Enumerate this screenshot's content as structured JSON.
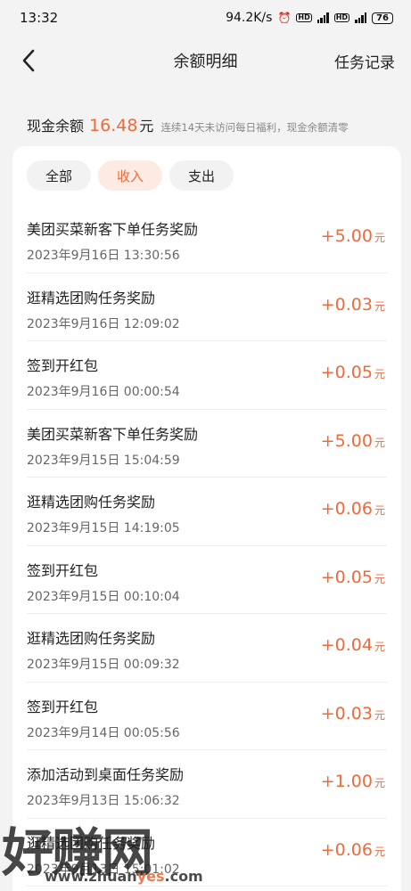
{
  "status_bar": {
    "time": "13:32",
    "network_speed": "94.2K/s",
    "battery": "76"
  },
  "nav": {
    "title": "余额明细",
    "right_link": "任务记录"
  },
  "balance": {
    "label": "现金余额",
    "amount": "16.48",
    "unit": "元",
    "note": "连续14天未访问每日福利，现金余额清零"
  },
  "tabs": [
    {
      "label": "全部",
      "active": false
    },
    {
      "label": "收入",
      "active": true
    },
    {
      "label": "支出",
      "active": false
    }
  ],
  "records": [
    {
      "title": "美团买菜新客下单任务奖励",
      "time": "2023年9月16日 13:30:56",
      "amount": "+5.00",
      "unit": "元"
    },
    {
      "title": "逛精选团购任务奖励",
      "time": "2023年9月16日 12:09:02",
      "amount": "+0.03",
      "unit": "元"
    },
    {
      "title": "签到开红包",
      "time": "2023年9月16日 00:00:54",
      "amount": "+0.05",
      "unit": "元"
    },
    {
      "title": "美团买菜新客下单任务奖励",
      "time": "2023年9月15日 15:04:59",
      "amount": "+5.00",
      "unit": "元"
    },
    {
      "title": "逛精选团购任务奖励",
      "time": "2023年9月15日 14:19:05",
      "amount": "+0.06",
      "unit": "元"
    },
    {
      "title": "签到开红包",
      "time": "2023年9月15日 00:10:04",
      "amount": "+0.05",
      "unit": "元"
    },
    {
      "title": "逛精选团购任务奖励",
      "time": "2023年9月15日 00:09:32",
      "amount": "+0.04",
      "unit": "元"
    },
    {
      "title": "签到开红包",
      "time": "2023年9月14日 00:05:56",
      "amount": "+0.03",
      "unit": "元"
    },
    {
      "title": "添加活动到桌面任务奖励",
      "time": "2023年9月13日 15:06:32",
      "amount": "+1.00",
      "unit": "元"
    },
    {
      "title": "逛精选团购任务奖励",
      "time": "2023年9月13日 15:01:02",
      "amount": "+0.06",
      "unit": "元"
    }
  ],
  "watermark": {
    "brand": "好赚网",
    "url_prefix": "www.zhuan",
    "url_accent": "yes",
    "url_suffix": ".com"
  },
  "colors": {
    "accent": "#ef6a3b",
    "active_tab_bg": "#fdebe3"
  }
}
